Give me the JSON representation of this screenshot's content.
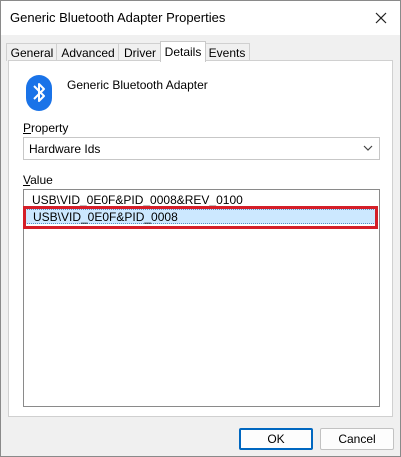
{
  "window": {
    "title": "Generic Bluetooth Adapter Properties"
  },
  "tabs": [
    {
      "label": "General"
    },
    {
      "label": "Advanced"
    },
    {
      "label": "Driver"
    },
    {
      "label": "Details",
      "active": true
    },
    {
      "label": "Events"
    }
  ],
  "device": {
    "name": "Generic Bluetooth Adapter",
    "icon": "bluetooth-icon",
    "icon_color": "#1a73e8"
  },
  "property": {
    "label_first": "P",
    "label_rest": "roperty",
    "selected": "Hardware Ids"
  },
  "value": {
    "label_first": "V",
    "label_rest": "alue",
    "items": [
      {
        "text": "USB\\VID_0E0F&PID_0008&REV_0100"
      },
      {
        "text": "USB\\VID_0E0F&PID_0008",
        "selected": true
      }
    ]
  },
  "buttons": {
    "ok": "OK",
    "cancel": "Cancel"
  },
  "colors": {
    "highlight_border": "#d41e28",
    "selection": "#cce8ff",
    "accent": "#0067c0"
  }
}
